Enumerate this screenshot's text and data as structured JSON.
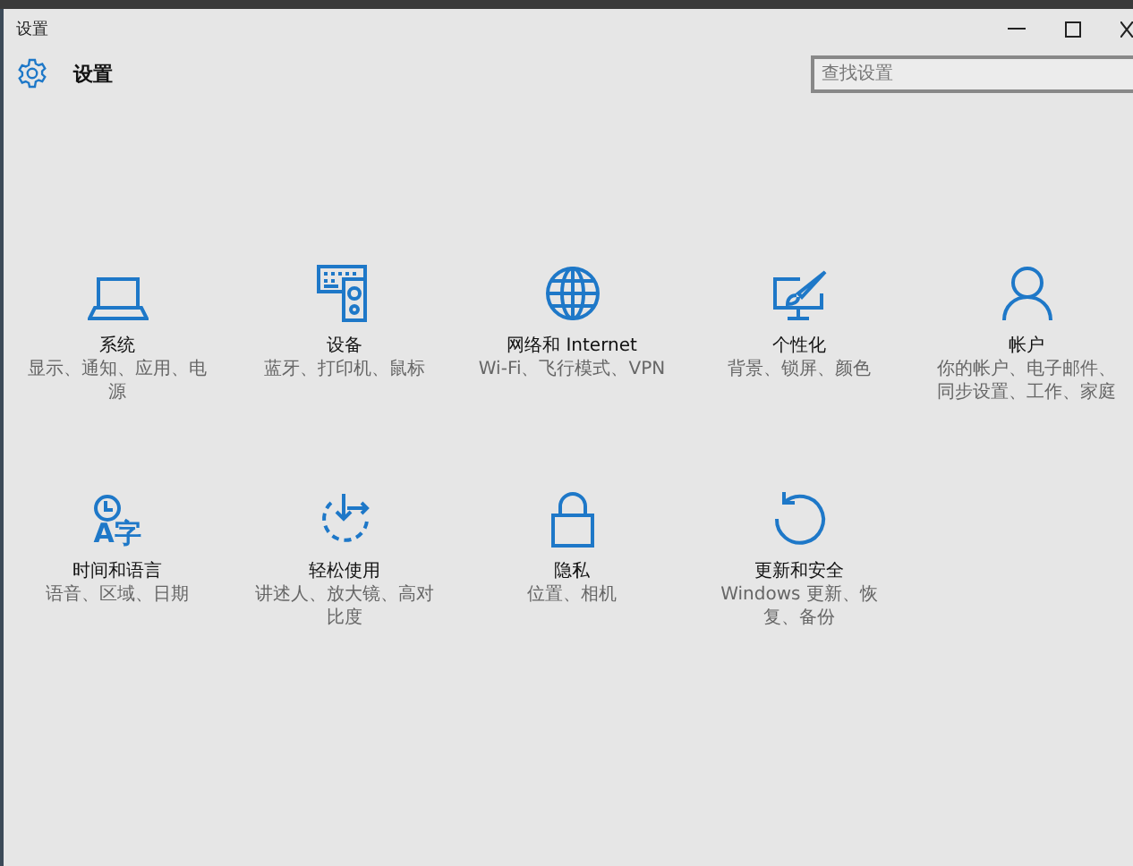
{
  "window": {
    "title": "设置"
  },
  "header": {
    "title": "设置"
  },
  "search": {
    "placeholder": "查找设置"
  },
  "categories": [
    {
      "kind": "laptop",
      "title": "系统",
      "description": "显示、通知、应用、电源"
    },
    {
      "kind": "devices",
      "title": "设备",
      "description": "蓝牙、打印机、鼠标"
    },
    {
      "kind": "globe",
      "title": "网络和 Internet",
      "description": "Wi-Fi、飞行模式、VPN"
    },
    {
      "kind": "personalize",
      "title": "个性化",
      "description": "背景、锁屏、颜色"
    },
    {
      "kind": "person",
      "title": "帐户",
      "description": "你的帐户、电子邮件、同步设置、工作、家庭"
    },
    {
      "kind": "timelang",
      "title": "时间和语言",
      "description": "语音、区域、日期",
      "icon_text": "A字"
    },
    {
      "kind": "ease",
      "title": "轻松使用",
      "description": "讲述人、放大镜、高对比度"
    },
    {
      "kind": "lock",
      "title": "隐私",
      "description": "位置、相机"
    },
    {
      "kind": "update",
      "title": "更新和安全",
      "description": "Windows 更新、恢复、备份"
    }
  ]
}
